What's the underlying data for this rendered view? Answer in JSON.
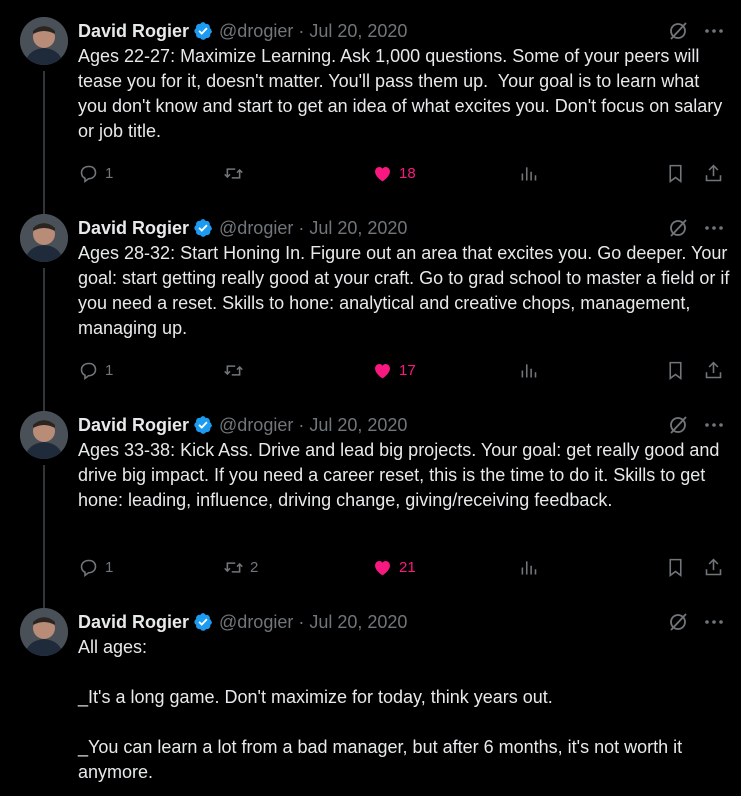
{
  "author": {
    "name": "David Rogier",
    "handle": "@drogier",
    "separator": "·",
    "date": "Jul 20, 2020"
  },
  "tweets": [
    {
      "text": "Ages 22-27: Maximize Learning. Ask 1,000 questions. Some of your peers will tease you for it, doesn't matter. You'll pass them up.  Your goal is to learn what you don't know and start to get an idea of what excites you. Don't focus on salary or job title.",
      "replies": "1",
      "retweets": "",
      "likes": "18"
    },
    {
      "text": "Ages 28-32: Start Honing In. Figure out an area that excites you. Go deeper. Your goal: start getting really good at your craft. Go to grad school to master a field or if you need a reset. Skills to hone: analytical and creative chops, management, managing up.",
      "replies": "1",
      "retweets": "",
      "likes": "17"
    },
    {
      "text": "Ages 33-38: Kick Ass. Drive and lead big projects. Your goal: get really good and drive big impact. If you need a career reset, this is the time to do it. Skills to get hone: leading, influence, driving change, giving/receiving feedback.",
      "replies": "1",
      "retweets": "2",
      "likes": "21"
    },
    {
      "text": "All ages:\n\n_It's a long game. Don't maximize for today, think years out.\n\n_You can learn a lot from a bad manager, but after 6 months, it's not worth it anymore."
    }
  ],
  "colors": {
    "background": "#000000",
    "text": "#e7e9ea",
    "secondary": "#71767b",
    "like": "#f91880",
    "verified": "#1d9bf0"
  },
  "icons": [
    "verified-badge-icon",
    "grok-icon",
    "more-icon",
    "reply-icon",
    "retweet-icon",
    "heart-icon",
    "views-icon",
    "bookmark-icon",
    "share-icon"
  ]
}
